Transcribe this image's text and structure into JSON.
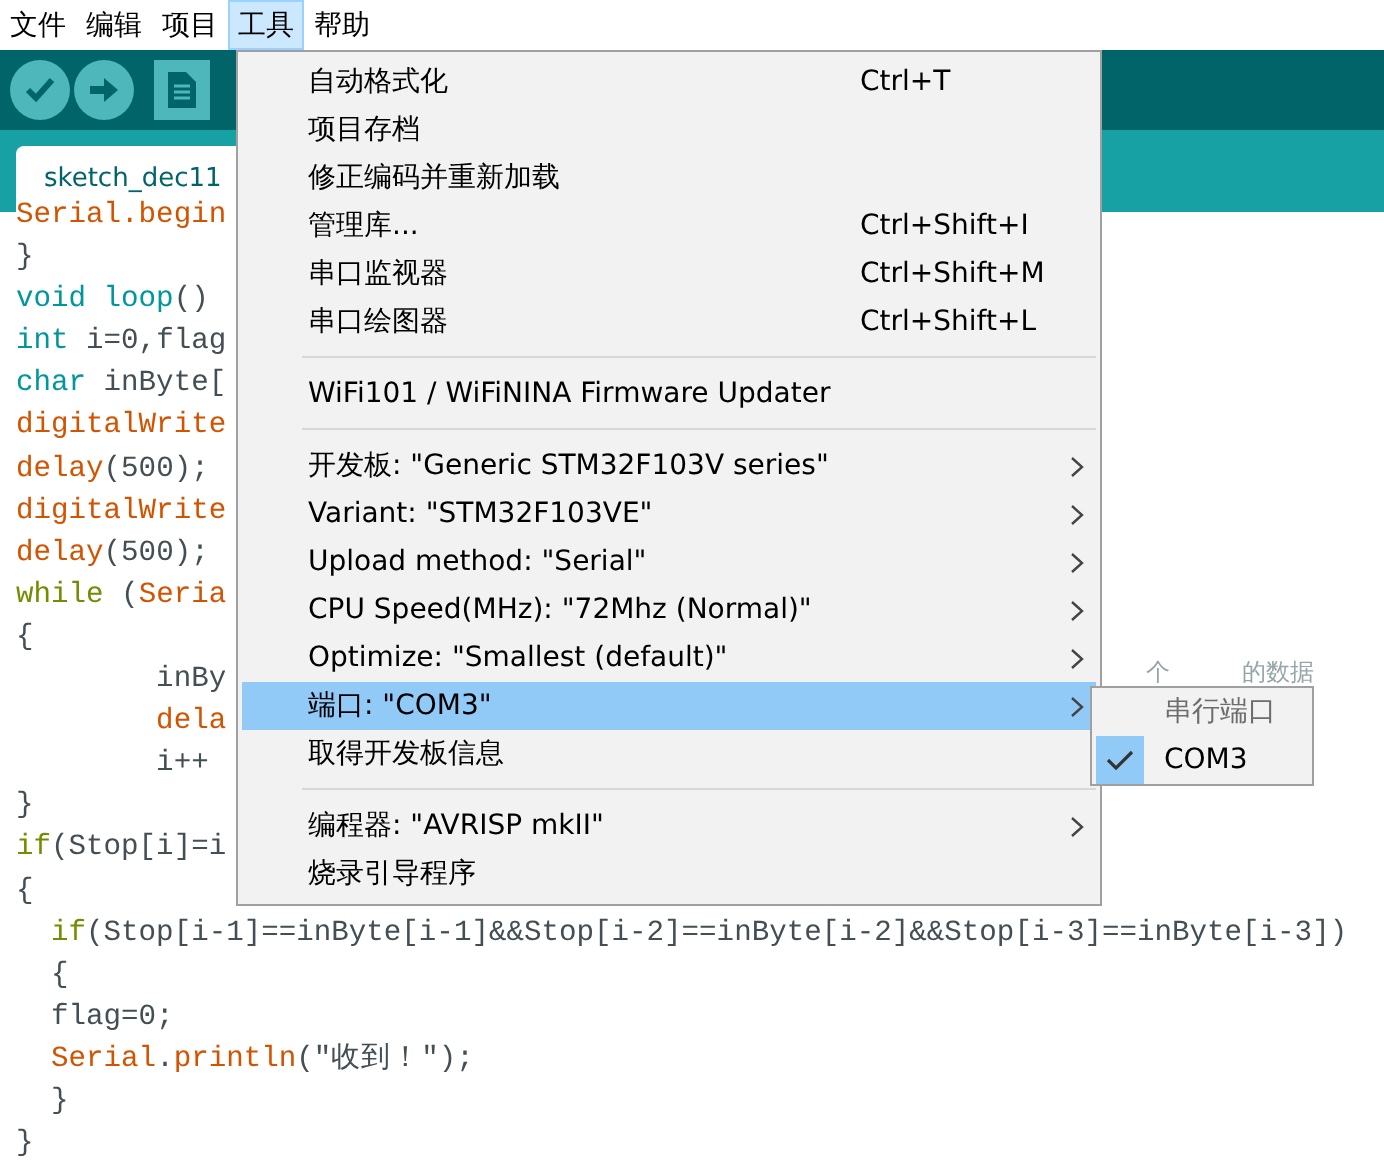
{
  "menu_bar": [
    {
      "label": "文件",
      "selected": false
    },
    {
      "label": "编辑",
      "selected": false
    },
    {
      "label": "项目",
      "selected": false
    },
    {
      "label": "工具",
      "selected": true
    },
    {
      "label": "帮助",
      "selected": false
    }
  ],
  "toolbar": [
    {
      "kind": "verify"
    },
    {
      "kind": "upload"
    },
    {
      "kind": "new"
    }
  ],
  "tab": {
    "label": "sketch_dec11"
  },
  "code_lines": [
    {
      "tokens": [
        {
          "text": "Serial.begin",
          "kind": "function"
        }
      ]
    },
    {
      "tokens": [
        {
          "text": "}",
          "kind": "plain"
        }
      ]
    },
    {
      "tokens": [
        {
          "text": "void",
          "kind": "type"
        },
        {
          "text": " loop",
          "kind": "type"
        },
        {
          "text": "()",
          "kind": "plain"
        }
      ]
    },
    {
      "tokens": [
        {
          "text": "int",
          "kind": "type"
        },
        {
          "text": " i=0,flag",
          "kind": "plain"
        }
      ]
    },
    {
      "tokens": [
        {
          "text": "char",
          "kind": "type"
        },
        {
          "text": " inByte[",
          "kind": "plain"
        }
      ]
    },
    {
      "tokens": [
        {
          "text": "digitalWrite",
          "kind": "function"
        }
      ]
    },
    {
      "tokens": [
        {
          "text": "delay",
          "kind": "function"
        },
        {
          "text": "(500);",
          "kind": "plain"
        }
      ]
    },
    {
      "tokens": [
        {
          "text": "digitalWrite",
          "kind": "function"
        }
      ]
    },
    {
      "tokens": [
        {
          "text": "delay",
          "kind": "function"
        },
        {
          "text": "(500);",
          "kind": "plain"
        }
      ]
    },
    {
      "tokens": [
        {
          "text": "while",
          "kind": "control"
        },
        {
          "text": " (",
          "kind": "plain"
        },
        {
          "text": "Seria",
          "kind": "function"
        }
      ]
    },
    {
      "tokens": [
        {
          "text": "{",
          "kind": "plain"
        }
      ]
    },
    {
      "tokens": [
        {
          "text": "        inBy",
          "kind": "plain"
        },
        {
          "text": "个",
          "kind": "comment"
        },
        {
          "text": "的数据",
          "kind": "comment"
        }
      ]
    },
    {
      "tokens": [
        {
          "text": "        dela",
          "kind": "function"
        }
      ]
    },
    {
      "tokens": [
        {
          "text": "        i++",
          "kind": "plain"
        }
      ]
    },
    {
      "tokens": [
        {
          "text": "}",
          "kind": "plain"
        }
      ]
    },
    {
      "tokens": [
        {
          "text": "if",
          "kind": "control"
        },
        {
          "text": "(Stop[i]=i",
          "kind": "plain"
        }
      ]
    },
    {
      "tokens": [
        {
          "text": "{",
          "kind": "plain"
        }
      ]
    },
    {
      "tokens": [
        {
          "text": "  if",
          "kind": "control"
        },
        {
          "text": "(Stop[i-1]==inByte[i-1]&&Stop[i-2]==inByte[i-2]&&Stop[i-3]==inByte[i-3])",
          "kind": "plain"
        }
      ]
    },
    {
      "tokens": [
        {
          "text": "  {",
          "kind": "plain"
        }
      ]
    },
    {
      "tokens": [
        {
          "text": "  flag=0;",
          "kind": "plain"
        }
      ]
    },
    {
      "tokens": [
        {
          "text": "  Serial",
          "kind": "function"
        },
        {
          "text": ".",
          "kind": "plain"
        },
        {
          "text": "println",
          "kind": "function"
        },
        {
          "text": "(\"收到！\");",
          "kind": "plain"
        }
      ]
    },
    {
      "tokens": [
        {
          "text": "  }",
          "kind": "plain"
        }
      ]
    },
    {
      "tokens": [
        {
          "text": "}",
          "kind": "plain"
        }
      ]
    }
  ],
  "tools_menu": [
    {
      "kind": "item",
      "label": "自动格式化",
      "shortcut": "Ctrl+T",
      "selected": false
    },
    {
      "kind": "item",
      "label": "项目存档",
      "selected": false
    },
    {
      "kind": "item",
      "label": "修正编码并重新加载",
      "selected": false
    },
    {
      "kind": "item",
      "label": "管理库...",
      "shortcut": "Ctrl+Shift+I",
      "selected": false
    },
    {
      "kind": "item",
      "label": "串口监视器",
      "shortcut": "Ctrl+Shift+M",
      "selected": false
    },
    {
      "kind": "item",
      "label": "串口绘图器",
      "shortcut": "Ctrl+Shift+L",
      "selected": false
    },
    {
      "kind": "separator"
    },
    {
      "kind": "item",
      "label": "WiFi101 / WiFiNINA Firmware Updater",
      "selected": false
    },
    {
      "kind": "separator"
    },
    {
      "kind": "submenu",
      "label": "开发板: \"Generic STM32F103V series\"",
      "selected": false
    },
    {
      "kind": "submenu",
      "label": "Variant: \"STM32F103VE\"",
      "selected": false
    },
    {
      "kind": "submenu",
      "label": "Upload method: \"Serial\"",
      "selected": false
    },
    {
      "kind": "submenu",
      "label": "CPU Speed(MHz): \"72Mhz (Normal)\"",
      "selected": false
    },
    {
      "kind": "submenu",
      "label": "Optimize: \"Smallest (default)\"",
      "selected": false
    },
    {
      "kind": "submenu",
      "label": "端口: \"COM3\"",
      "selected": true
    },
    {
      "kind": "item",
      "label": "取得开发板信息",
      "selected": false
    },
    {
      "kind": "separator"
    },
    {
      "kind": "submenu",
      "label": "编程器: \"AVRISP mkII\"",
      "selected": false
    },
    {
      "kind": "item",
      "label": "烧录引导程序",
      "selected": false
    }
  ],
  "port_submenu": [
    {
      "label": "串行端口",
      "disabled": true,
      "checked": false
    },
    {
      "label": "COM3",
      "disabled": false,
      "checked": true
    }
  ]
}
